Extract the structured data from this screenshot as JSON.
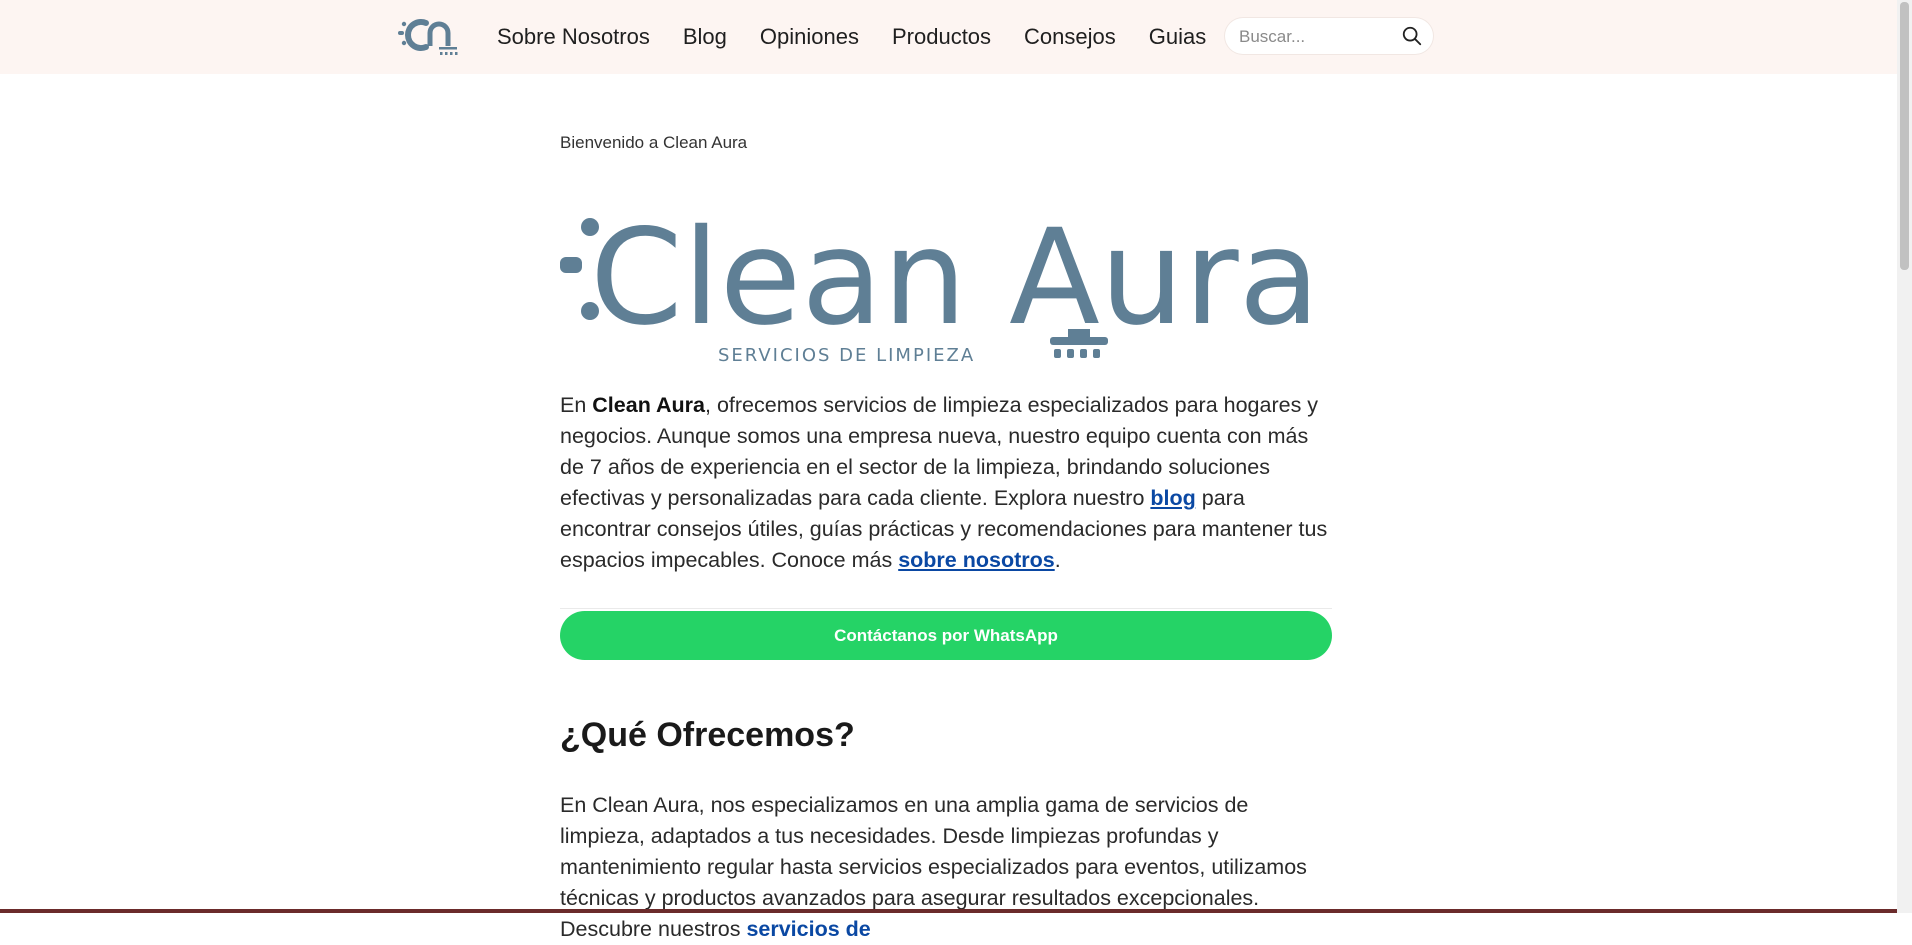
{
  "header": {
    "nav": [
      {
        "label": "Sobre Nosotros"
      },
      {
        "label": "Blog"
      },
      {
        "label": "Opiniones"
      },
      {
        "label": "Productos"
      },
      {
        "label": "Consejos"
      },
      {
        "label": "Guias"
      }
    ],
    "search": {
      "placeholder": "Buscar...",
      "value": "",
      "icon": "search-icon"
    },
    "logo_icon": "ca-logo-icon"
  },
  "main": {
    "welcome": "Bienvenido a Clean Aura",
    "hero_logo": {
      "brand": "Clean Aura",
      "tagline": "SERVICIOS DE LIMPIEZA"
    },
    "intro": {
      "p1": "En ",
      "brand": "Clean Aura",
      "p2": ", ofrecemos servicios de limpieza especializados para hogares y negocios. Aunque somos una empresa nueva, nuestro equipo cuenta con más de 7 años de experiencia en el sector de la limpieza, brindando soluciones efectivas y personalizadas para cada cliente. Explora nuestro ",
      "blog_link": "blog",
      "p3": " para encontrar consejos útiles, guías prácticas y recomendaciones para mantener tus espacios impecables. Conoce más ",
      "about_link": "sobre nosotros",
      "p4": "."
    },
    "cta_label": "Contáctanos por WhatsApp",
    "section_title": "¿Qué Ofrecemos?",
    "section_text": {
      "text": "En Clean Aura, nos especializamos en una amplia gama de servicios de limpieza, adaptados a tus necesidades. Desde limpiezas profundas y mantenimiento regular hasta servicios especializados para eventos, utilizamos técnicas y productos avanzados para asegurar resultados excepcionales. Descubre nuestros ",
      "link": "servicios de"
    }
  },
  "colors": {
    "header_bg": "#fdf5f2",
    "brand_blue_gray": "#5f7f95",
    "link": "#0a48a3",
    "whatsapp_green": "#25d366"
  }
}
